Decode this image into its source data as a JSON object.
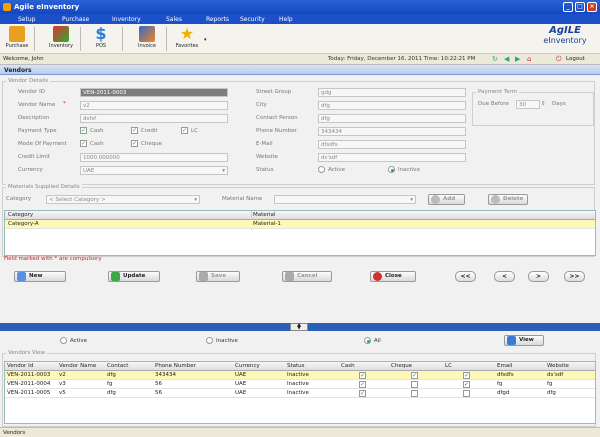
{
  "app": {
    "title": "Agile eInventory"
  },
  "menu": [
    "Setup",
    "Purchase",
    "Inventory",
    "Sales",
    "Reports",
    "Security",
    "Help"
  ],
  "toolbar": {
    "items": [
      "Purchase",
      "Inventory",
      "POS",
      "Invoice",
      "Favorites"
    ]
  },
  "logo": {
    "top": "AgILE",
    "bottom": "eInventory"
  },
  "userbar": {
    "welcome": "Welcome, John",
    "datetime": "Today: Friday, December 16, 2011  Time: 10:22:21 PM",
    "logout": "Logout"
  },
  "tab": {
    "vendors": "Vendors"
  },
  "details": {
    "legend": "Vendor Details",
    "vendor_id_label": "Vendor ID",
    "vendor_id": "VEN-2011-0003",
    "vendor_name_label": "Vendor Name",
    "vendor_name": "v2",
    "description_label": "Description",
    "description": "dsfsf",
    "payment_type_label": "Payment Type",
    "cash": "Cash",
    "credit": "Credit",
    "lc": "LC",
    "mode_of_payment_label": "Mode Of Payment",
    "cheque": "Cheque",
    "credit_limit_label": "Credit Limit",
    "credit_limit": "1000.000000",
    "currency_label": "Currency",
    "currency": "UAE",
    "street_label": "Street Group",
    "street": "gdg",
    "city_label": "City",
    "city": "dfg",
    "contact_label": "Contact Person",
    "contact": "dfg",
    "phone_label": "Phone Number",
    "phone": "343434",
    "email_label": "E-Mail",
    "email": "dfsdfs",
    "website_label": "Website",
    "website": "ds'sdf",
    "status_label": "Status",
    "active": "Active",
    "inactive": "Inactive"
  },
  "payment_term": {
    "legend": "Payment Term",
    "label": "Due Before",
    "value": "30",
    "unit": "Days"
  },
  "materials": {
    "legend": "Materials Supplied Details",
    "category_label": "Category",
    "category_placeholder": "< Select Category >",
    "material_label": "Material Name",
    "add": "Add",
    "delete": "Delete",
    "col_category": "Category",
    "col_material": "Material",
    "rows": [
      {
        "category": "Category-A",
        "material": "Material-1"
      }
    ]
  },
  "compulsory_note": "Field marked with * are compulsory",
  "actions": {
    "new": "New",
    "update": "Update",
    "save": "Save",
    "cancel": "Cancel",
    "close": "Close"
  },
  "nav": [
    "<<",
    "<",
    ">",
    ">>"
  ],
  "filter": {
    "active": "Active",
    "inactive": "Inactive",
    "all": "All",
    "view": "View"
  },
  "vendors_view": {
    "legend": "Vendors View",
    "headers": [
      "Vendor Id",
      "Vendor Name",
      "Contact",
      "Phone Number",
      "Currency",
      "Status",
      "Cash",
      "Cheque",
      "LC",
      "Email",
      "Website"
    ],
    "rows": [
      {
        "id": "VEN-2011-0003",
        "name": "v2",
        "contact": "dfg",
        "phone": "343434",
        "currency": "UAE",
        "status": "Inactive",
        "cash": true,
        "cheque": true,
        "lc": true,
        "email": "dfsdfs",
        "website": "ds'sdf"
      },
      {
        "id": "VEN-2011-0004",
        "name": "v3",
        "contact": "fg",
        "phone": "56",
        "currency": "UAE",
        "status": "Inactive",
        "cash": true,
        "cheque": false,
        "lc": true,
        "email": "fg",
        "website": "fg"
      },
      {
        "id": "VEN-2011-0005",
        "name": "v5",
        "contact": "dfg",
        "phone": "56",
        "currency": "UAE",
        "status": "Inactive",
        "cash": true,
        "cheque": false,
        "lc": false,
        "email": "dfgd",
        "website": "dfg"
      }
    ]
  },
  "status": {
    "text": "Vendors"
  }
}
